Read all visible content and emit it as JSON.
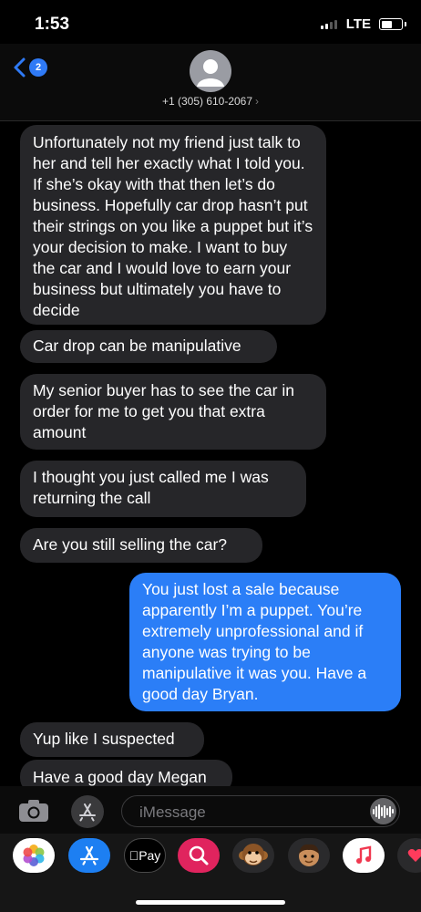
{
  "status_bar": {
    "time": "1:53",
    "network": "LTE"
  },
  "header": {
    "back_badge": "2",
    "contact": "+1 (305) 610-2067",
    "chevron": "›"
  },
  "messages": [
    {
      "sender": "other",
      "text": "Unfortunately not my friend just talk to her and tell her exactly what I told you. If she’s okay with that then let’s do business. Hopefully car drop hasn’t put their strings on you like a puppet but it’s your decision to make. I want to buy the car and I would love to earn your business but ultimately you have to decide"
    },
    {
      "sender": "other",
      "text": "Car drop can be manipulative"
    },
    {
      "sender": "other",
      "text": "My senior buyer has to see the car in order for me to get you that extra amount"
    },
    {
      "sender": "other",
      "text": "I thought you just called me I was returning the call"
    },
    {
      "sender": "other",
      "text": "Are you still selling the car?"
    },
    {
      "sender": "me",
      "text": "You just lost a sale because apparently I’m a puppet. You’re extremely unprofessional and if anyone was trying to be manipulative it was you. Have a good day Bryan."
    },
    {
      "sender": "other",
      "text": "Yup like I suspected"
    },
    {
      "sender": "other",
      "text": "Have a good day Megan"
    }
  ],
  "composer": {
    "placeholder": "iMessage"
  },
  "app_drawer": [
    {
      "name": "photos-icon"
    },
    {
      "name": "app-store-icon"
    },
    {
      "name": "apple-pay-icon",
      "label": "Pay"
    },
    {
      "name": "image-search-icon"
    },
    {
      "name": "monkey-memoji-icon"
    },
    {
      "name": "memoji-icon"
    },
    {
      "name": "music-icon"
    },
    {
      "name": "digital-touch-icon"
    }
  ],
  "colors": {
    "incoming": "#262629",
    "outgoing": "#2b7ef7",
    "accent": "#2f7af6"
  }
}
